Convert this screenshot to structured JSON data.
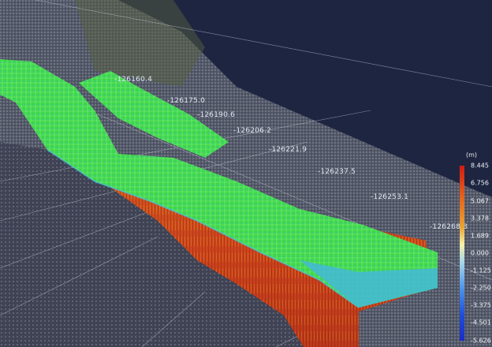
{
  "axis_labels": [
    "-126160.4",
    "-126175.0",
    "-126190.6",
    "-126206.2",
    "-126221.9",
    "-126237.5",
    "-126253.1",
    "-126268.8"
  ],
  "legend": {
    "unit": "(m)",
    "ticks": [
      "8.445",
      "6.756",
      "5.067",
      "3.378",
      "1.689",
      "0.000",
      "-1.125",
      "-2.250",
      "-3.375",
      "-4.501",
      "-5.626"
    ]
  },
  "colors": {
    "background": "#1d2541",
    "surface_high": "#2ad44a",
    "surface_mid": "#8fe85a",
    "wall_fill": "#d2461e",
    "wall_edge": "#3fa7c9"
  }
}
